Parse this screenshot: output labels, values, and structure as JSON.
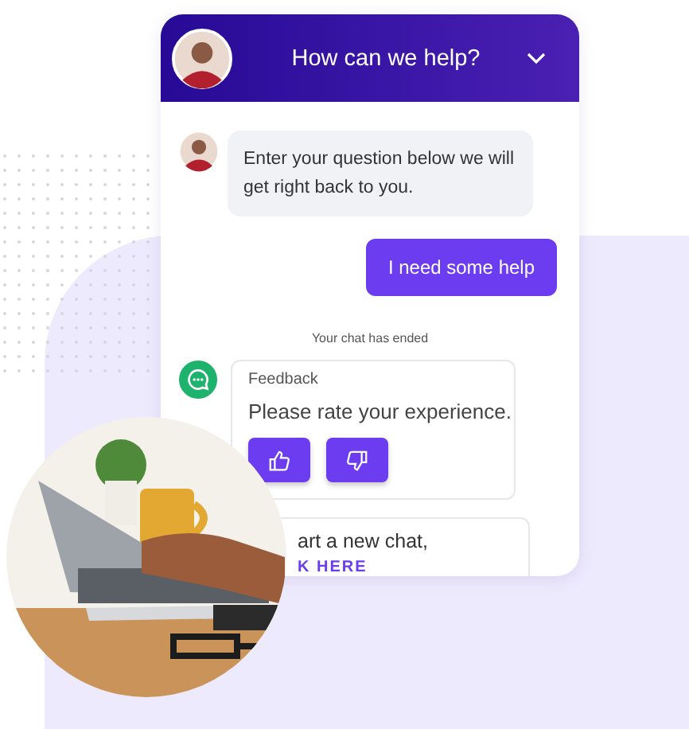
{
  "header": {
    "title": "How can we help?"
  },
  "messages": [
    {
      "kind": "agent",
      "text": "Enter your question below we will get right back to you."
    },
    {
      "kind": "user",
      "text": "I need some help"
    }
  ],
  "status": "Your chat has ended",
  "feedback": {
    "label": "Feedback",
    "prompt": "Please rate your experience."
  },
  "restart": {
    "text": "art a new chat,",
    "link": "K HERE"
  }
}
